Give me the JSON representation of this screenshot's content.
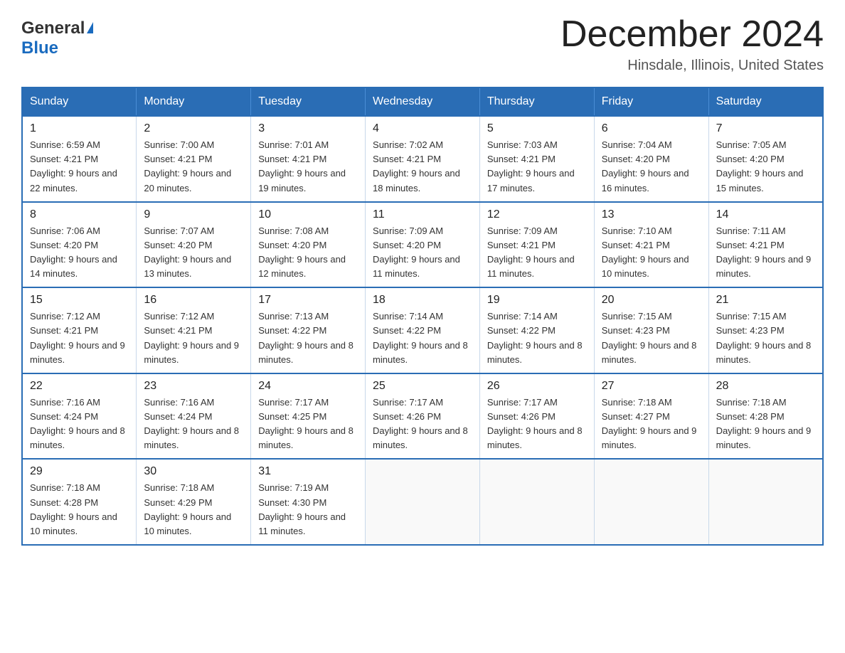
{
  "header": {
    "logo": {
      "general": "General",
      "blue": "Blue",
      "tagline": "GeneralBlue"
    },
    "title": "December 2024",
    "location": "Hinsdale, Illinois, United States"
  },
  "weekdays": [
    "Sunday",
    "Monday",
    "Tuesday",
    "Wednesday",
    "Thursday",
    "Friday",
    "Saturday"
  ],
  "weeks": [
    [
      {
        "day": "1",
        "sunrise": "6:59 AM",
        "sunset": "4:21 PM",
        "daylight": "9 hours and 22 minutes."
      },
      {
        "day": "2",
        "sunrise": "7:00 AM",
        "sunset": "4:21 PM",
        "daylight": "9 hours and 20 minutes."
      },
      {
        "day": "3",
        "sunrise": "7:01 AM",
        "sunset": "4:21 PM",
        "daylight": "9 hours and 19 minutes."
      },
      {
        "day": "4",
        "sunrise": "7:02 AM",
        "sunset": "4:21 PM",
        "daylight": "9 hours and 18 minutes."
      },
      {
        "day": "5",
        "sunrise": "7:03 AM",
        "sunset": "4:21 PM",
        "daylight": "9 hours and 17 minutes."
      },
      {
        "day": "6",
        "sunrise": "7:04 AM",
        "sunset": "4:20 PM",
        "daylight": "9 hours and 16 minutes."
      },
      {
        "day": "7",
        "sunrise": "7:05 AM",
        "sunset": "4:20 PM",
        "daylight": "9 hours and 15 minutes."
      }
    ],
    [
      {
        "day": "8",
        "sunrise": "7:06 AM",
        "sunset": "4:20 PM",
        "daylight": "9 hours and 14 minutes."
      },
      {
        "day": "9",
        "sunrise": "7:07 AM",
        "sunset": "4:20 PM",
        "daylight": "9 hours and 13 minutes."
      },
      {
        "day": "10",
        "sunrise": "7:08 AM",
        "sunset": "4:20 PM",
        "daylight": "9 hours and 12 minutes."
      },
      {
        "day": "11",
        "sunrise": "7:09 AM",
        "sunset": "4:20 PM",
        "daylight": "9 hours and 11 minutes."
      },
      {
        "day": "12",
        "sunrise": "7:09 AM",
        "sunset": "4:21 PM",
        "daylight": "9 hours and 11 minutes."
      },
      {
        "day": "13",
        "sunrise": "7:10 AM",
        "sunset": "4:21 PM",
        "daylight": "9 hours and 10 minutes."
      },
      {
        "day": "14",
        "sunrise": "7:11 AM",
        "sunset": "4:21 PM",
        "daylight": "9 hours and 9 minutes."
      }
    ],
    [
      {
        "day": "15",
        "sunrise": "7:12 AM",
        "sunset": "4:21 PM",
        "daylight": "9 hours and 9 minutes."
      },
      {
        "day": "16",
        "sunrise": "7:12 AM",
        "sunset": "4:21 PM",
        "daylight": "9 hours and 9 minutes."
      },
      {
        "day": "17",
        "sunrise": "7:13 AM",
        "sunset": "4:22 PM",
        "daylight": "9 hours and 8 minutes."
      },
      {
        "day": "18",
        "sunrise": "7:14 AM",
        "sunset": "4:22 PM",
        "daylight": "9 hours and 8 minutes."
      },
      {
        "day": "19",
        "sunrise": "7:14 AM",
        "sunset": "4:22 PM",
        "daylight": "9 hours and 8 minutes."
      },
      {
        "day": "20",
        "sunrise": "7:15 AM",
        "sunset": "4:23 PM",
        "daylight": "9 hours and 8 minutes."
      },
      {
        "day": "21",
        "sunrise": "7:15 AM",
        "sunset": "4:23 PM",
        "daylight": "9 hours and 8 minutes."
      }
    ],
    [
      {
        "day": "22",
        "sunrise": "7:16 AM",
        "sunset": "4:24 PM",
        "daylight": "9 hours and 8 minutes."
      },
      {
        "day": "23",
        "sunrise": "7:16 AM",
        "sunset": "4:24 PM",
        "daylight": "9 hours and 8 minutes."
      },
      {
        "day": "24",
        "sunrise": "7:17 AM",
        "sunset": "4:25 PM",
        "daylight": "9 hours and 8 minutes."
      },
      {
        "day": "25",
        "sunrise": "7:17 AM",
        "sunset": "4:26 PM",
        "daylight": "9 hours and 8 minutes."
      },
      {
        "day": "26",
        "sunrise": "7:17 AM",
        "sunset": "4:26 PM",
        "daylight": "9 hours and 8 minutes."
      },
      {
        "day": "27",
        "sunrise": "7:18 AM",
        "sunset": "4:27 PM",
        "daylight": "9 hours and 9 minutes."
      },
      {
        "day": "28",
        "sunrise": "7:18 AM",
        "sunset": "4:28 PM",
        "daylight": "9 hours and 9 minutes."
      }
    ],
    [
      {
        "day": "29",
        "sunrise": "7:18 AM",
        "sunset": "4:28 PM",
        "daylight": "9 hours and 10 minutes."
      },
      {
        "day": "30",
        "sunrise": "7:18 AM",
        "sunset": "4:29 PM",
        "daylight": "9 hours and 10 minutes."
      },
      {
        "day": "31",
        "sunrise": "7:19 AM",
        "sunset": "4:30 PM",
        "daylight": "9 hours and 11 minutes."
      },
      null,
      null,
      null,
      null
    ]
  ]
}
